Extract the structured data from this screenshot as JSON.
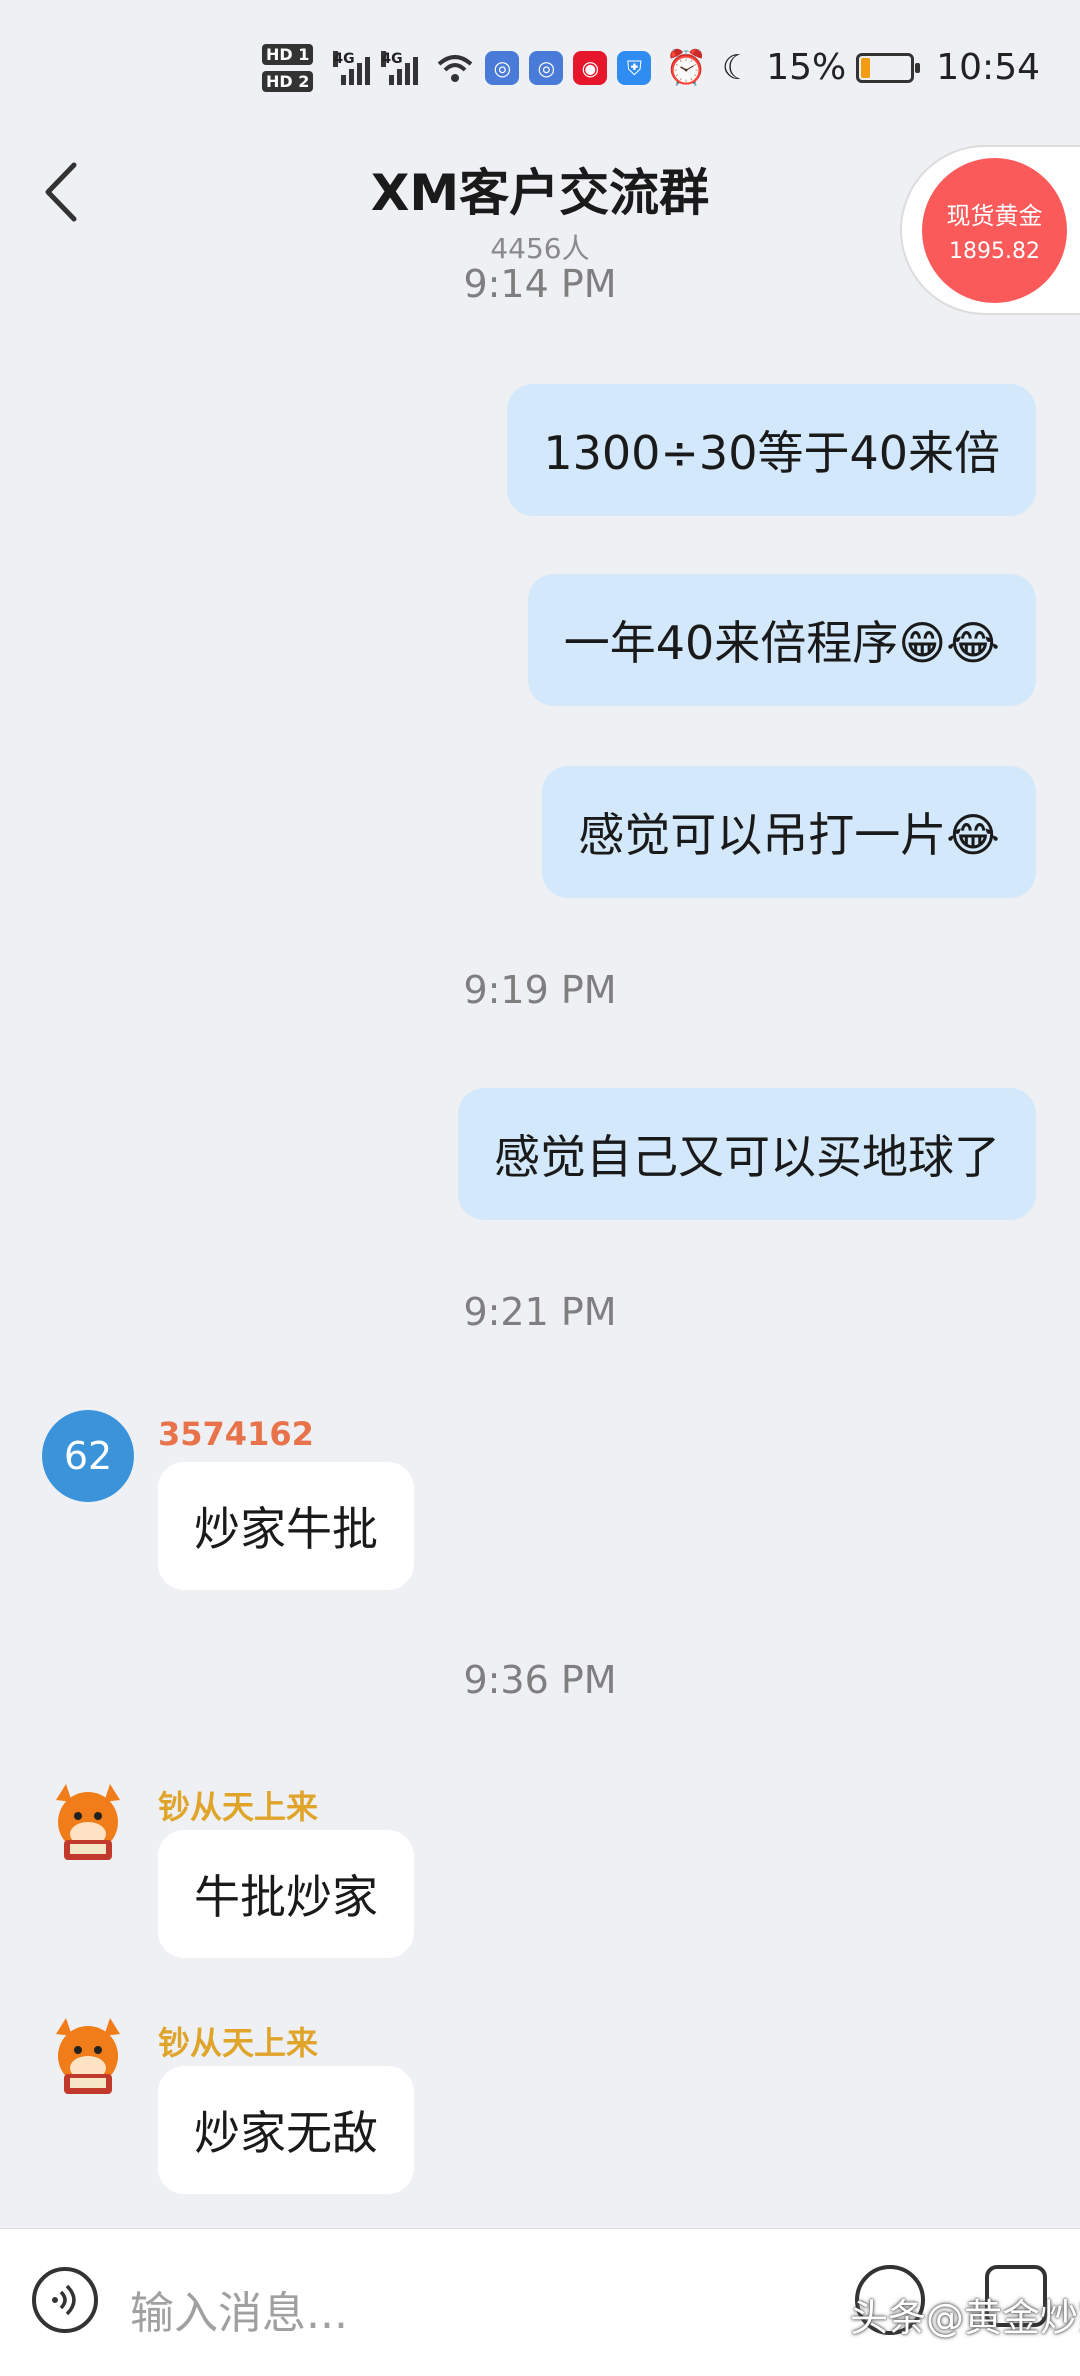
{
  "status_bar": {
    "hd1": "HD 1",
    "hd2": "HD 2",
    "net1": "4G",
    "net2": "4G",
    "battery_percent": "15%",
    "time": "10:54",
    "battery_color": "#f39c12"
  },
  "header": {
    "title": "XM客户交流群",
    "member_count": "4456人"
  },
  "gold_widget": {
    "name": "现货黄金",
    "price": "1895.82",
    "color": "#fb5a5a"
  },
  "messages": {
    "time_1": "9:14 PM",
    "out_1": "1300÷30等于40来倍",
    "out_2": "一年40来倍程序😁😂",
    "out_3": "感觉可以吊打一片😂",
    "time_2": "9:19 PM",
    "out_4": "感觉自己又可以买地球了",
    "time_3": "9:21 PM",
    "in_1": {
      "avatar_text": "62",
      "sender": "3574162",
      "sender_color": "#e8734a",
      "text": "炒家牛批"
    },
    "time_4": "9:36 PM",
    "in_2": {
      "sender": "钞从天上来",
      "sender_color": "#e0a42b",
      "text": "牛批炒家"
    },
    "in_3": {
      "sender": "钞从天上来",
      "sender_color": "#e0a42b",
      "text": "炒家无敌"
    }
  },
  "input_bar": {
    "placeholder": "输入消息...",
    "watermark": "头条@黄金炒家"
  },
  "colors": {
    "bubble_out": "#d4e8fb",
    "bubble_in": "#ffffff",
    "background": "#eef0f3"
  }
}
